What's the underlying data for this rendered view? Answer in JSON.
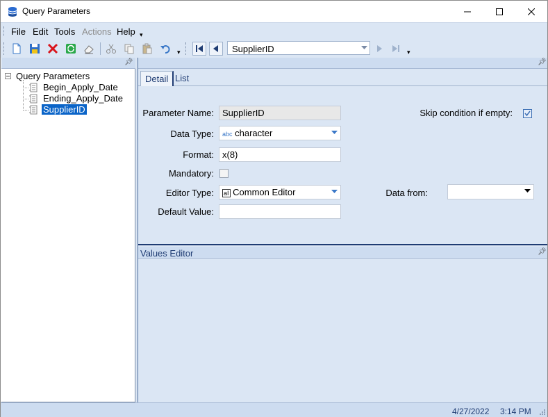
{
  "window": {
    "title": "Query Parameters"
  },
  "menu": {
    "items": [
      {
        "label": "File",
        "enabled": true
      },
      {
        "label": "Edit",
        "enabled": true
      },
      {
        "label": "Tools",
        "enabled": true
      },
      {
        "label": "Actions",
        "enabled": false
      },
      {
        "label": "Help",
        "enabled": true
      }
    ]
  },
  "toolbar": {
    "buttons": [
      "new-icon",
      "save-icon",
      "delete-icon",
      "refresh-icon",
      "eraser-icon",
      "cut-icon",
      "copy-icon",
      "paste-icon",
      "undo-icon"
    ],
    "nav_buttons": [
      "first-record-icon",
      "previous-record-icon",
      "next-record-icon",
      "last-record-icon"
    ],
    "nav_combo_value": "SupplierID"
  },
  "tree": {
    "root": "Query Parameters",
    "children": [
      "Begin_Apply_Date",
      "Ending_Apply_Date",
      "SupplierID"
    ],
    "selected": "SupplierID"
  },
  "tabs": [
    {
      "label": "Detail",
      "active": true
    },
    {
      "label": "List",
      "active": false
    }
  ],
  "detail": {
    "parameter_name_label": "Parameter Name:",
    "parameter_name_value": "SupplierID",
    "skip_label": "Skip condition if empty:",
    "skip_checked": true,
    "data_type_label": "Data Type:",
    "data_type_prefix": "abc",
    "data_type_value": "character",
    "format_label": "Format:",
    "format_value": "x(8)",
    "mandatory_label": "Mandatory:",
    "mandatory_checked": false,
    "editor_type_label": "Editor Type:",
    "editor_type_prefix": "aI",
    "editor_type_value": "Common Editor",
    "data_from_label": "Data from:",
    "data_from_value": "",
    "default_value_label": "Default Value:",
    "default_value_value": ""
  },
  "values_editor": {
    "title": "Values Editor"
  },
  "status": {
    "date": "4/27/2022",
    "time": "3:14 PM"
  },
  "colors": {
    "panel_bg": "#dbe6f4",
    "header_bg": "#cddcf0",
    "accent": "#1f3c73",
    "selection": "#0a64c8"
  }
}
